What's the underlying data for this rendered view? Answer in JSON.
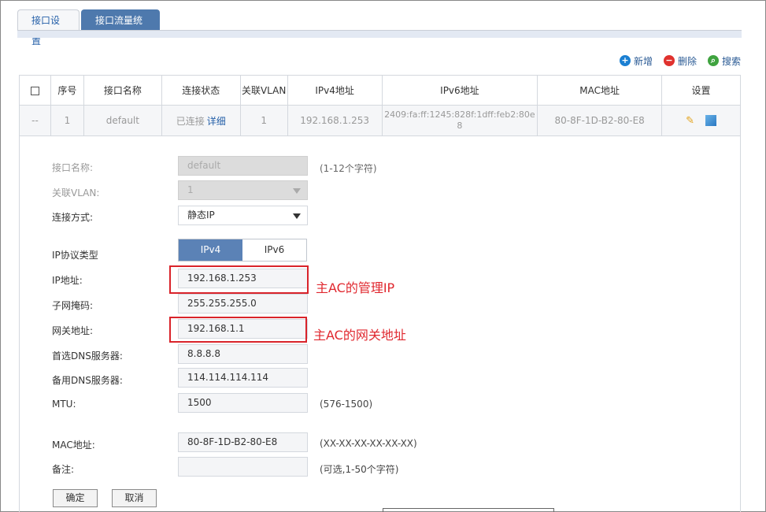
{
  "tabs": [
    "接口设置",
    "接口流量统计"
  ],
  "toolbar": {
    "add": "新增",
    "delete": "删除",
    "search": "搜索"
  },
  "table": {
    "headers": [
      "序号",
      "接口名称",
      "连接状态",
      "关联VLAN",
      "IPv4地址",
      "IPv6地址",
      "MAC地址",
      "设置"
    ],
    "row": {
      "check": "--",
      "index": "1",
      "name": "default",
      "status": "已连接",
      "detail": "详细",
      "vlan": "1",
      "ipv4": "192.168.1.253",
      "ipv6": "2409:fa:ff:1245:828f:1dff:feb2:80e8",
      "mac": "80-8F-1D-B2-80-E8"
    }
  },
  "form": {
    "name_label": "接口名称:",
    "name_value": "default",
    "name_hint": "(1-12个字符)",
    "vlan_label": "关联VLAN:",
    "vlan_value": "1",
    "mode_label": "连接方式:",
    "mode_value": "静态IP",
    "proto_label": "IP协议类型",
    "proto_ipv4": "IPv4",
    "proto_ipv6": "IPv6",
    "ip_label": "IP地址:",
    "ip_value": "192.168.1.253",
    "mask_label": "子网掩码:",
    "mask_value": "255.255.255.0",
    "gw_label": "网关地址:",
    "gw_value": "192.168.1.1",
    "dns1_label": "首选DNS服务器:",
    "dns1_value": "8.8.8.8",
    "dns2_label": "备用DNS服务器:",
    "dns2_value": "114.114.114.114",
    "mtu_label": "MTU:",
    "mtu_value": "1500",
    "mtu_hint": "(576-1500)",
    "mac_label": "MAC地址:",
    "mac_value": "80-8F-1D-B2-80-E8",
    "mac_hint": "(XX-XX-XX-XX-XX-XX)",
    "remark_label": "备注:",
    "remark_value": "",
    "remark_hint": "(可选,1-50个字符)",
    "ok": "确定",
    "cancel": "取消"
  },
  "annotations": {
    "ip_note": "主AC的管理IP",
    "gw_note": "主AC的网关地址"
  },
  "colors": {
    "tab_active": "#4e79ad",
    "seg_active": "#5b82b6",
    "annotation": "#d9232a"
  },
  "icons": {
    "add": "plus-circle-icon",
    "delete": "minus-circle-icon",
    "search": "magnifier-icon",
    "edit": "pencil-icon",
    "link": "link-icon"
  }
}
